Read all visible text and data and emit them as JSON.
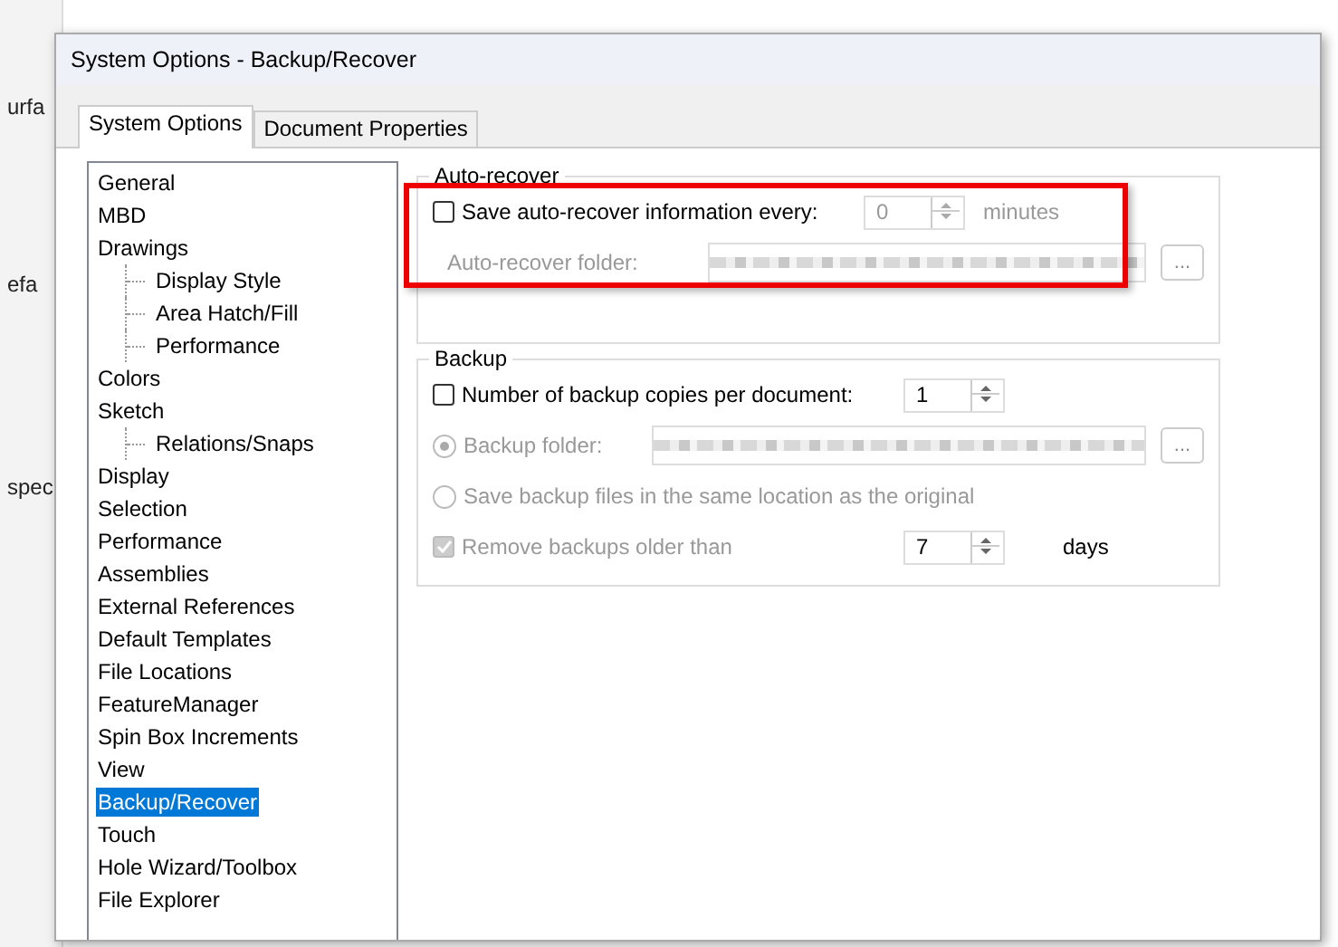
{
  "background_app": {
    "fragments": [
      "urfa",
      "efa",
      "spec"
    ]
  },
  "window": {
    "title": "System Options - Backup/Recover"
  },
  "tabs": [
    {
      "label": "System Options",
      "selected": true
    },
    {
      "label": "Document Properties",
      "selected": false
    }
  ],
  "tree": [
    {
      "label": "General",
      "selected": false
    },
    {
      "label": "MBD",
      "selected": false
    },
    {
      "label": "Drawings",
      "selected": false,
      "children": [
        {
          "label": "Display Style",
          "selected": false
        },
        {
          "label": "Area Hatch/Fill",
          "selected": false
        },
        {
          "label": "Performance",
          "selected": false
        }
      ]
    },
    {
      "label": "Colors",
      "selected": false
    },
    {
      "label": "Sketch",
      "selected": false,
      "children": [
        {
          "label": "Relations/Snaps",
          "selected": false
        }
      ]
    },
    {
      "label": "Display",
      "selected": false
    },
    {
      "label": "Selection",
      "selected": false
    },
    {
      "label": "Performance",
      "selected": false
    },
    {
      "label": "Assemblies",
      "selected": false
    },
    {
      "label": "External References",
      "selected": false
    },
    {
      "label": "Default Templates",
      "selected": false
    },
    {
      "label": "File Locations",
      "selected": false
    },
    {
      "label": "FeatureManager",
      "selected": false
    },
    {
      "label": "Spin Box Increments",
      "selected": false
    },
    {
      "label": "View",
      "selected": false
    },
    {
      "label": "Backup/Recover",
      "selected": true
    },
    {
      "label": "Touch",
      "selected": false
    },
    {
      "label": "Hole Wizard/Toolbox",
      "selected": false
    },
    {
      "label": "File Explorer",
      "selected": false
    }
  ],
  "groups": [
    {
      "title": "Auto-recover",
      "highlighted": true,
      "rows": [
        {
          "kind": "spin",
          "label": "Save auto-recover information every:",
          "checked": false,
          "disabled": false,
          "value": "0",
          "unit": "minutes",
          "spin_disabled": true
        },
        {
          "kind": "folder",
          "label": "Auto-recover folder:",
          "disabled": true,
          "browse": "..."
        }
      ]
    },
    {
      "title": "Backup",
      "highlighted": false,
      "rows": [
        {
          "kind": "spin",
          "label": "Number of backup copies per document:",
          "checked": false,
          "disabled": false,
          "value": "1",
          "spin_disabled": false
        },
        {
          "kind": "radio-folder",
          "label": "Backup folder:",
          "selected": true,
          "disabled": true,
          "browse": "..."
        },
        {
          "kind": "radio",
          "label": "Save backup files in the same location as the original",
          "selected": false,
          "disabled": true
        },
        {
          "kind": "spin",
          "label": "Remove backups older than",
          "checked": true,
          "disabled": true,
          "value": "7",
          "unit": "days",
          "spin_disabled": false
        }
      ]
    }
  ]
}
